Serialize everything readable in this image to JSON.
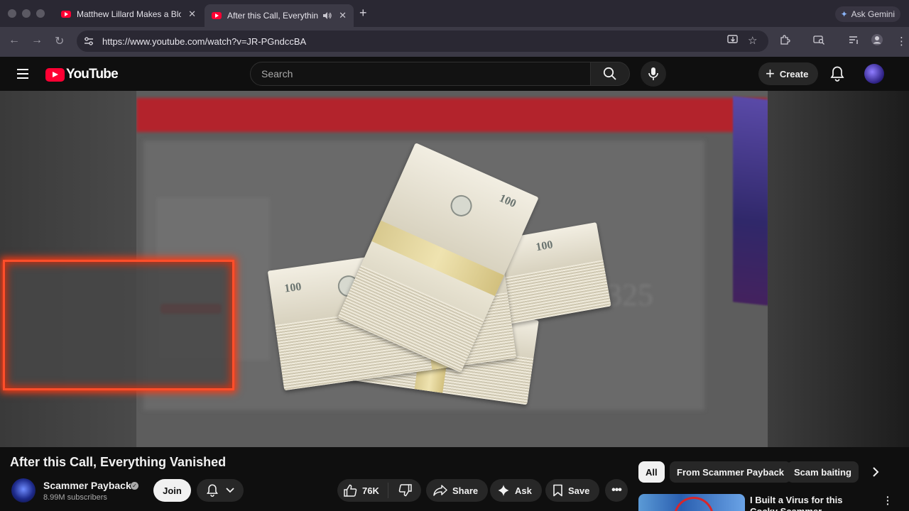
{
  "browser": {
    "tabs": [
      {
        "title": "Matthew Lillard Makes a Bloo",
        "active": false
      },
      {
        "title": "After this Call, Everything",
        "active": true
      }
    ],
    "new_tab_glyph": "+",
    "tab_close_glyph": "✕",
    "gemini_label": "Ask Gemini",
    "url": "https://www.youtube.com/watch?v=JR-PGndccBA"
  },
  "masthead": {
    "logo_text": "YouTube",
    "search_placeholder": "Search",
    "create_label": "Create"
  },
  "video": {
    "title": "After this Call, Everything Vanished",
    "price_overlay": "$325"
  },
  "channel": {
    "name": "Scammer Payback",
    "subscribers": "8.99M subscribers",
    "join_label": "Join"
  },
  "actions": {
    "like_count": "76K",
    "share_label": "Share",
    "ask_label": "Ask",
    "save_label": "Save"
  },
  "chips": [
    {
      "label": "All",
      "active": true
    },
    {
      "label": "From Scammer Payback",
      "active": false
    },
    {
      "label": "Scam baiting",
      "active": false
    }
  ],
  "recommendation": {
    "title": "I Built a Virus for this Cocky Scammer"
  },
  "colors": {
    "youtube_red": "#ff0033",
    "background": "#0f0f0f",
    "fire_border": "#ff4e2a"
  }
}
